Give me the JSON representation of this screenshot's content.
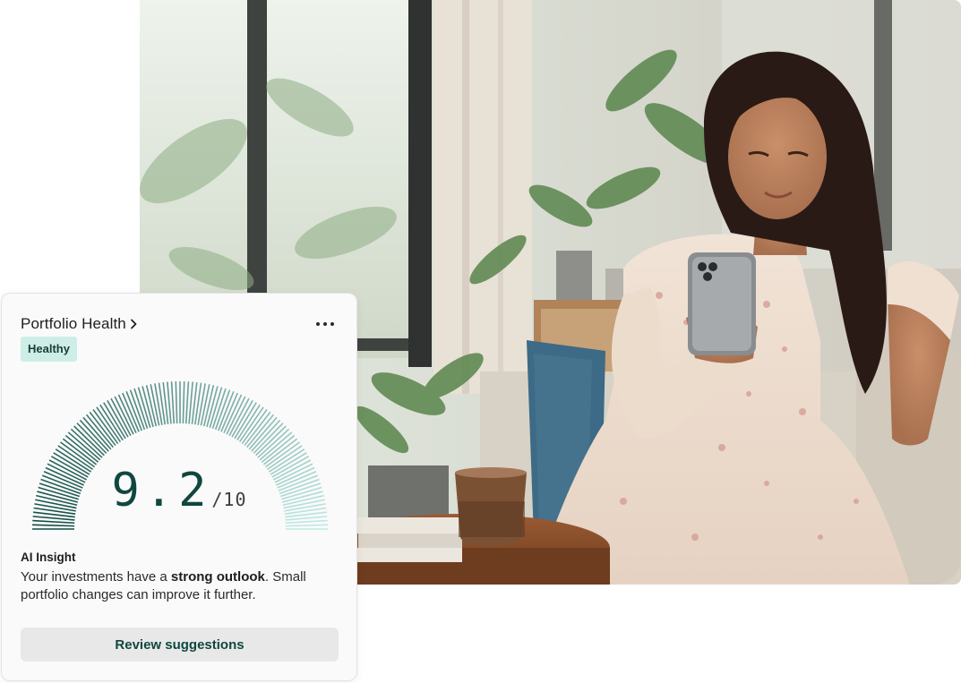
{
  "photo": {
    "alt": "Woman sitting on a sofa smiling at her smartphone"
  },
  "card": {
    "title": "Portfolio Health",
    "status_badge": "Healthy",
    "score": {
      "value": "9.2",
      "max": "/10",
      "fraction": 0.92
    },
    "insight": {
      "label": "AI Insight",
      "text_before": "Your investments have a ",
      "text_bold": "strong outlook",
      "text_after": ". Small portfolio changes can improve it further."
    },
    "action_label": "Review suggestions",
    "icons": {
      "title_chevron": "chevron-right-icon",
      "menu": "more-horizontal-icon"
    },
    "colors": {
      "accent_dark": "#10473f",
      "gauge_start": "#0f4d44",
      "gauge_end": "#bfe9e3",
      "badge_bg": "#cdeee6"
    }
  }
}
